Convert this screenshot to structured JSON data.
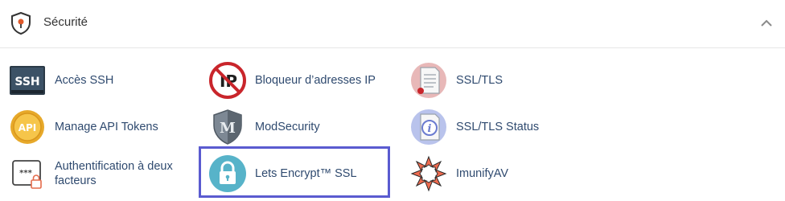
{
  "section": {
    "title": "Sécurité",
    "shield_icon": "shield-icon",
    "collapse_icon": "chevron-up-icon"
  },
  "items": [
    {
      "label": "Accès SSH",
      "icon": "ssh-terminal-icon"
    },
    {
      "label": "Manage API Tokens",
      "icon": "api-coin-icon"
    },
    {
      "label": "Authentification à deux facteurs",
      "icon": "two-factor-auth-icon"
    },
    {
      "label": "Bloqueur d’adresses IP",
      "icon": "ip-blocker-icon"
    },
    {
      "label": "ModSecurity",
      "icon": "modsecurity-shield-icon"
    },
    {
      "label": "Lets Encrypt™ SSL",
      "icon": "lock-icon"
    },
    {
      "label": "SSL/TLS",
      "icon": "certificate-icon"
    },
    {
      "label": "SSL/TLS Status",
      "icon": "certificate-status-icon"
    },
    {
      "label": "ImunifyAV",
      "icon": "imunify-icon"
    }
  ],
  "highlight_color": "#5a5bd0"
}
